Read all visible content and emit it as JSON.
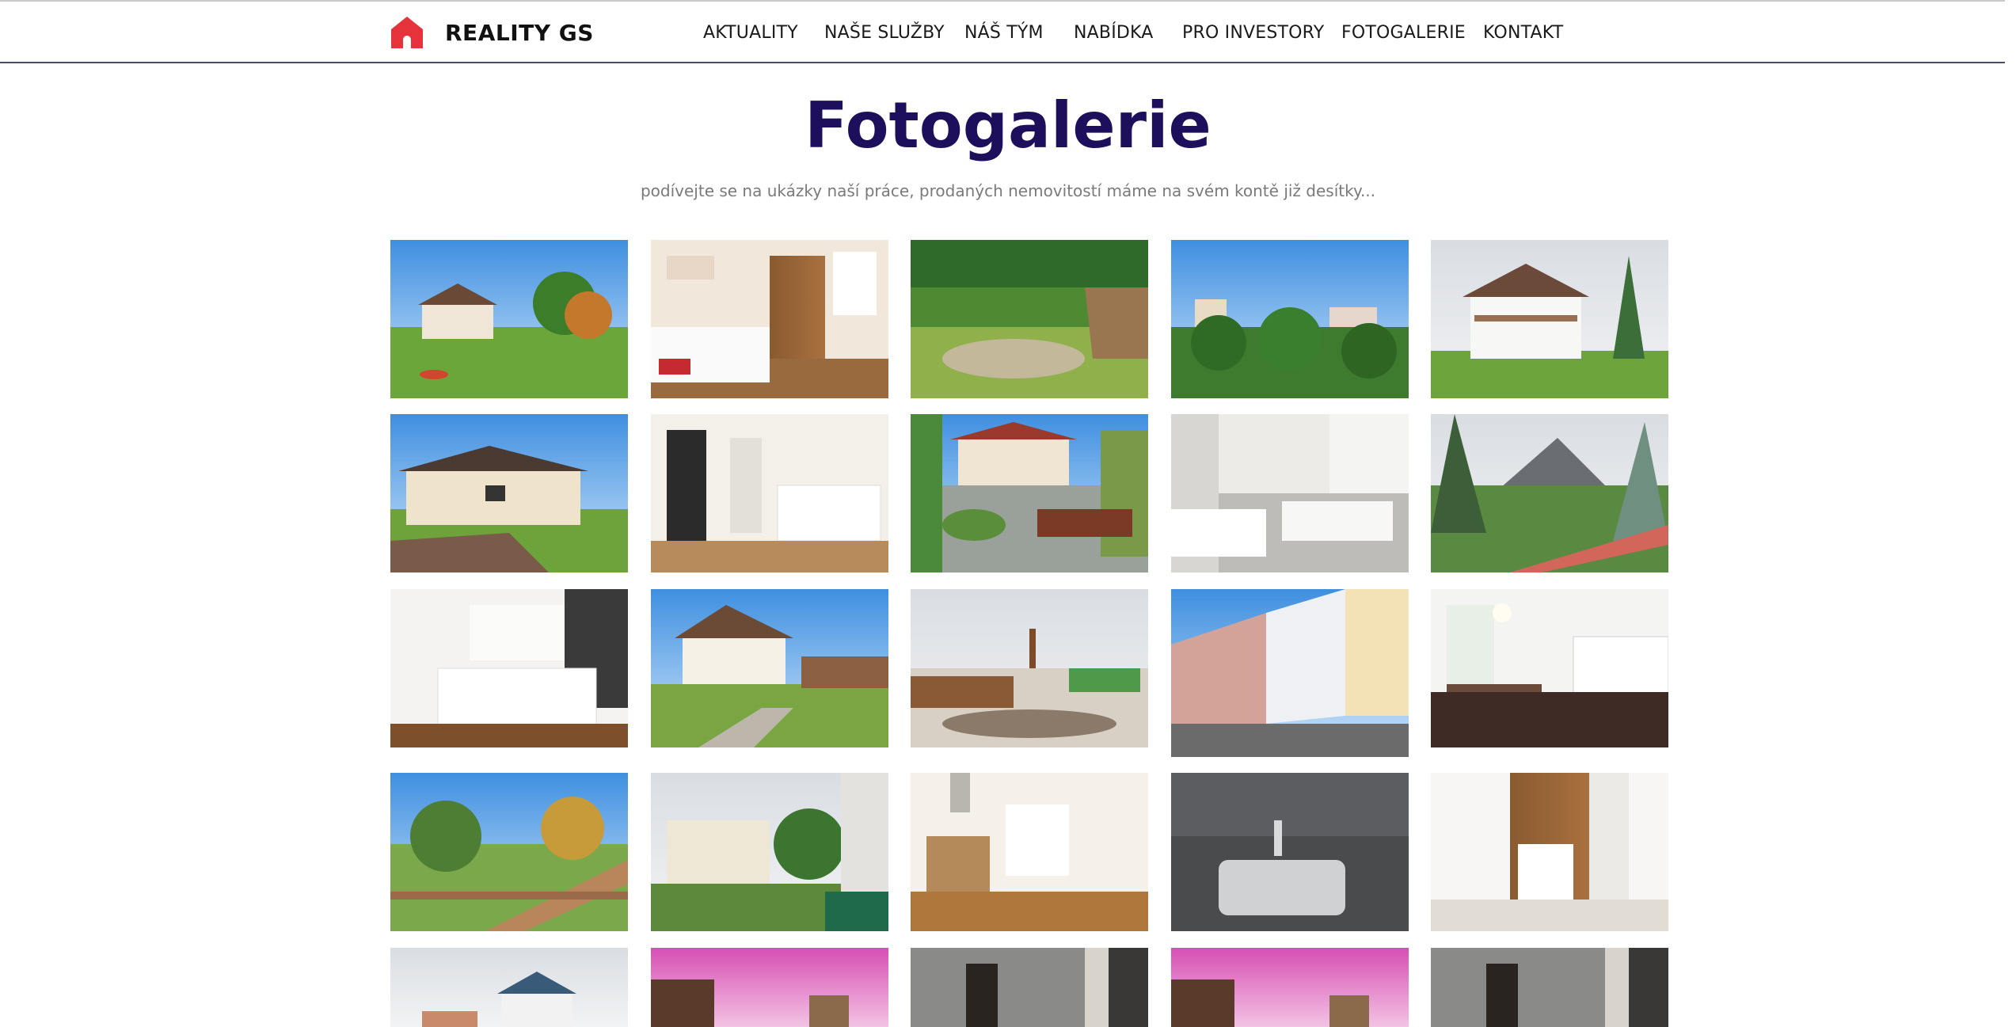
{
  "brand": {
    "name": "REALITY GS",
    "logo_icon": "house-logo-icon",
    "accent": "#e5333b"
  },
  "nav": {
    "items": [
      {
        "label": "AKTUALITY"
      },
      {
        "label": "NAŠE SLUŽBY"
      },
      {
        "label": "NÁŠ TÝM"
      },
      {
        "label": "NABÍDKA"
      },
      {
        "label": "PRO INVESTORY"
      },
      {
        "label": "FOTOGALERIE"
      },
      {
        "label": "KONTAKT"
      }
    ]
  },
  "page": {
    "title": "Fotogalerie",
    "subtitle": "podívejte se na ukázky naší práce, prodaných nemovitostí máme na svém kontě již desítky...",
    "title_color": "#1e0f5c"
  },
  "gallery": {
    "photos": [
      {
        "subject": "garden-house-exterior"
      },
      {
        "subject": "bedroom-interior"
      },
      {
        "subject": "garden-terrace"
      },
      {
        "subject": "city-trees-view"
      },
      {
        "subject": "villa-exterior"
      },
      {
        "subject": "bungalow-exterior"
      },
      {
        "subject": "hallway-kitchen-interior"
      },
      {
        "subject": "garden-bench"
      },
      {
        "subject": "bathroom-bathtub"
      },
      {
        "subject": "balcony-mountain-view"
      },
      {
        "subject": "white-kitchen"
      },
      {
        "subject": "house-backyard"
      },
      {
        "subject": "backyard-garden"
      },
      {
        "subject": "street-buildings"
      },
      {
        "subject": "kitchen-dining"
      },
      {
        "subject": "balcony-garden-view"
      },
      {
        "subject": "apartment-block-view"
      },
      {
        "subject": "kitchen-living-room"
      },
      {
        "subject": "kitchen-sink"
      },
      {
        "subject": "bathroom-cabinet"
      },
      {
        "subject": "house-blue-sky"
      },
      {
        "subject": "pink-ceiling-room"
      },
      {
        "subject": "dark-hallway"
      },
      {
        "subject": "pink-ceiling-room"
      },
      {
        "subject": "dark-hallway"
      }
    ]
  }
}
